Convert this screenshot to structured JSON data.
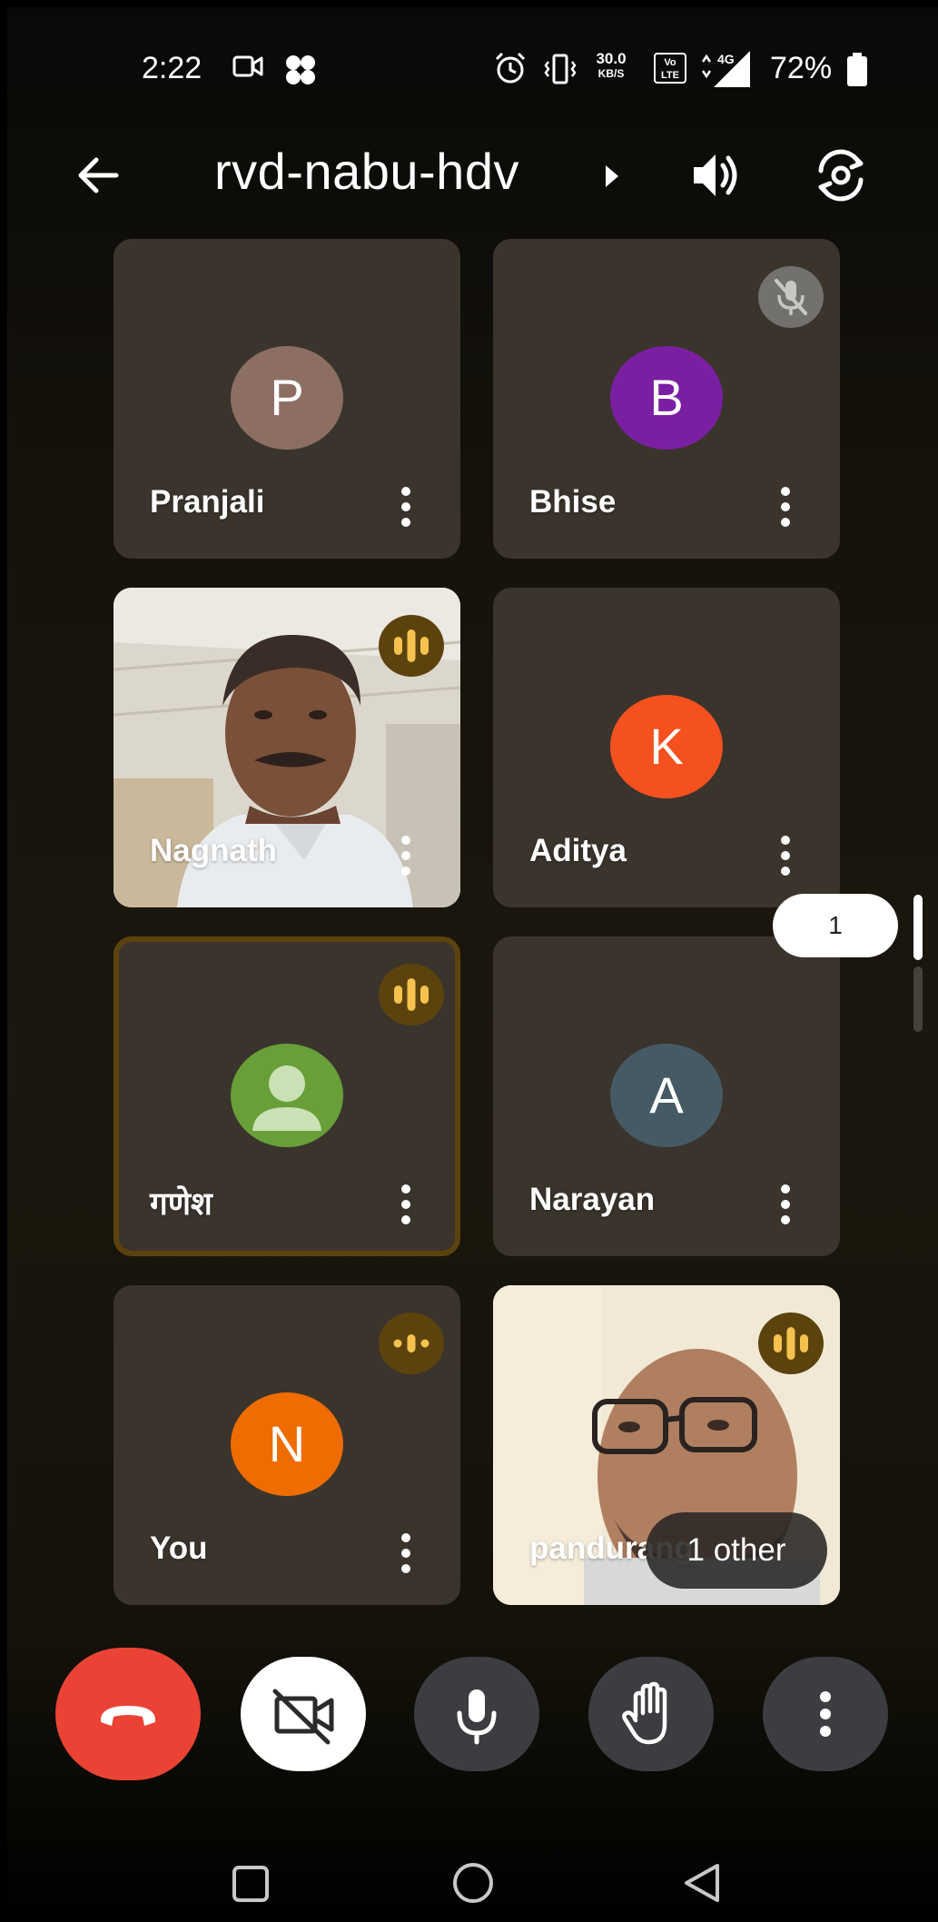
{
  "status_bar": {
    "time": "2:22",
    "speed_value": "30.0",
    "speed_unit": "KB/S",
    "volte": "Vo LTE",
    "network": "4G",
    "battery": "72%"
  },
  "header": {
    "meeting_code": "rvd-nabu-hdv",
    "icons": [
      "back-arrow-icon",
      "caret-right-icon",
      "speaker-icon",
      "camera-flip-icon"
    ]
  },
  "participants": [
    {
      "name": "Pranjali",
      "avatar_letter": "P",
      "avatar_color": "#8d6e63",
      "state": "avatar"
    },
    {
      "name": "Bhise",
      "avatar_letter": "B",
      "avatar_color": "#7b1fa2",
      "state": "muted"
    },
    {
      "name": "Nagnath",
      "state": "speaking-video"
    },
    {
      "name": "Aditya",
      "avatar_letter": "K",
      "avatar_color": "#f4511e",
      "state": "avatar"
    },
    {
      "name": "गणेश",
      "avatar_color": "#689f38",
      "state": "speaking-active"
    },
    {
      "name": "Narayan",
      "avatar_letter": "A",
      "avatar_color": "#455a64",
      "state": "avatar"
    },
    {
      "name": "You",
      "avatar_letter": "N",
      "avatar_color": "#ef6c00",
      "state": "speaking"
    },
    {
      "name": "pandurang",
      "state": "speaking-video",
      "overlay": "1 other"
    }
  ],
  "scroll": {
    "page_indicator": "1"
  },
  "controls": {
    "icons": [
      "end-call-icon",
      "camera-off-icon",
      "microphone-icon",
      "raise-hand-icon",
      "more-options-icon"
    ],
    "colors": {
      "end_call": "#ea4335",
      "camera_off_bg": "#ffffff",
      "dark_button": "#3c3d41"
    }
  },
  "accent": {
    "speaking_indicator": "#5c430e",
    "speaking_bars": "#f5c24d"
  }
}
